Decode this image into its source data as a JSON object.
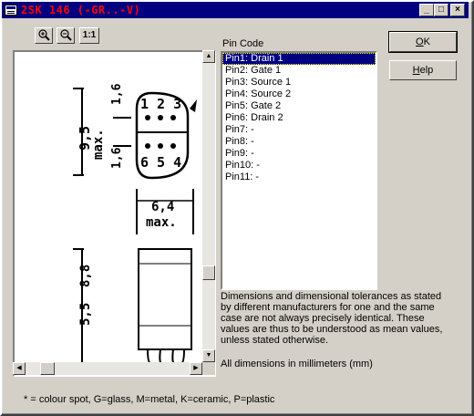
{
  "window": {
    "title": "2SK 146  (-GR..-V)"
  },
  "toolbar": {
    "zoom_in_label": "+",
    "zoom_out_label": "−",
    "zoom_reset_label": "1:1"
  },
  "pin_code": {
    "label": "Pin Code",
    "items": [
      {
        "label": "Pin1: Drain 1",
        "selected": true
      },
      {
        "label": "Pin2: Gate 1"
      },
      {
        "label": "Pin3: Source 1"
      },
      {
        "label": "Pin4: Source 2"
      },
      {
        "label": "Pin5: Gate 2"
      },
      {
        "label": "Pin6: Drain 2"
      },
      {
        "label": "Pin7: -"
      },
      {
        "label": "Pin8: -"
      },
      {
        "label": "Pin9: -"
      },
      {
        "label": "Pin10: -"
      },
      {
        "label": "Pin11: -"
      }
    ]
  },
  "buttons": {
    "ok_accel": "O",
    "ok_rest": "K",
    "help_accel": "H",
    "help_rest": "elp"
  },
  "description": "Dimensions and dimensional tolerances as stated by different manufacturers for one and the same case are not always precisely identical. These values are thus to be understood as mean values, unless stated otherwise.",
  "dims_note": "All dimensions in millimeters (mm)",
  "footnote": "* = colour spot, G=glass, M=metal, K=ceramic, P=plastic",
  "drawing": {
    "pins_top": "1 2 3",
    "pins_bottom": "6 5 4",
    "dim_95": "9,5",
    "dim_max": "max.",
    "dim_16a": "1,6",
    "dim_16b": "1,6",
    "dim_64": "6,4",
    "dim_max2": "max.",
    "dim_88": "8,8",
    "dim_55": "5,5"
  },
  "colors": {
    "titlebar": "#000080",
    "title_text": "#ff0000",
    "selection": "#000080"
  }
}
